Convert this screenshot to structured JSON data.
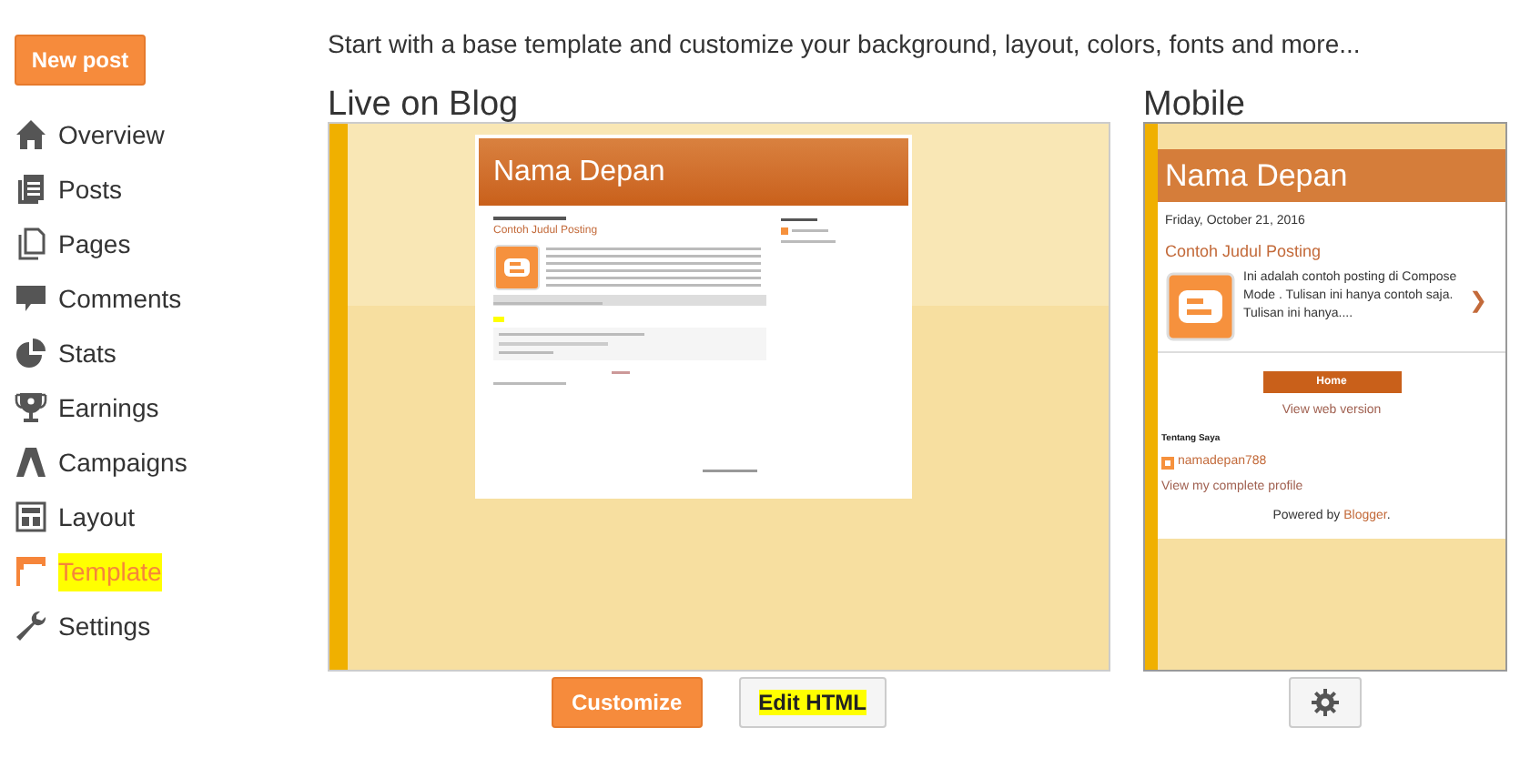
{
  "new_post_button": "New post",
  "nav": [
    {
      "kind": "home",
      "label": "Overview",
      "selected": false,
      "highlighted": false
    },
    {
      "kind": "posts",
      "label": "Posts",
      "selected": false,
      "highlighted": false
    },
    {
      "kind": "pages",
      "label": "Pages",
      "selected": false,
      "highlighted": false
    },
    {
      "kind": "comments",
      "label": "Comments",
      "selected": false,
      "highlighted": false
    },
    {
      "kind": "stats",
      "label": "Stats",
      "selected": false,
      "highlighted": false
    },
    {
      "kind": "earnings",
      "label": "Earnings",
      "selected": false,
      "highlighted": false
    },
    {
      "kind": "campaigns",
      "label": "Campaigns",
      "selected": false,
      "highlighted": false
    },
    {
      "kind": "layout",
      "label": "Layout",
      "selected": false,
      "highlighted": false
    },
    {
      "kind": "template",
      "label": "Template",
      "selected": true,
      "highlighted": true
    },
    {
      "kind": "settings",
      "label": "Settings",
      "selected": false,
      "highlighted": false
    }
  ],
  "intro": "Start with a base template and customize your background, layout, colors, fonts and more...",
  "live": {
    "heading": "Live on Blog",
    "blog_title": "Nama Depan",
    "post_title": "Contoh Judul Posting",
    "buttons": [
      {
        "kind": "primary",
        "label": "Customize",
        "highlighted": false
      },
      {
        "kind": "secondary",
        "label": "Edit HTML",
        "highlighted": true
      }
    ]
  },
  "mobile": {
    "heading": "Mobile",
    "blog_title": "Nama Depan",
    "date": "Friday, October 21, 2016",
    "post_title": "Contoh Judul Posting",
    "excerpt": "Ini adalah contoh posting di Compose Mode . Tulisan ini hanya contoh saja. Tulisan ini hanya....",
    "next": "❯",
    "home_button": "Home",
    "web_version_link": "View web version",
    "about_heading": "Tentang Saya",
    "profile_name": "namadepan788",
    "profile_link": "View my complete profile",
    "powered_prefix": "Powered by",
    "powered_link": "Blogger",
    "powered_suffix": "."
  }
}
